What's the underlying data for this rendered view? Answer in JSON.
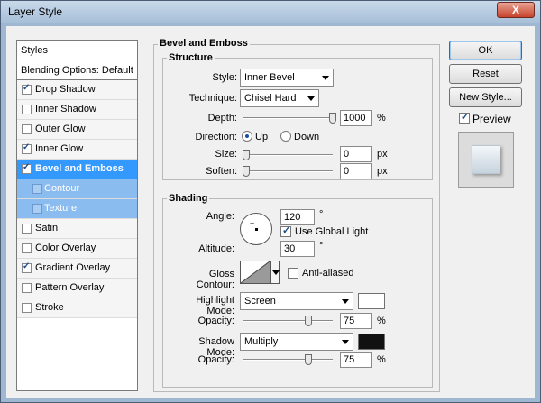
{
  "window": {
    "title": "Layer Style",
    "close_label": "X"
  },
  "left_panel": {
    "header": "Styles",
    "items": [
      {
        "label": "Blending Options: Default",
        "checkbox": false,
        "checked": false,
        "state": "header"
      },
      {
        "label": "Drop Shadow",
        "checkbox": true,
        "checked": true,
        "state": "normal"
      },
      {
        "label": "Inner Shadow",
        "checkbox": true,
        "checked": false,
        "state": "normal"
      },
      {
        "label": "Outer Glow",
        "checkbox": true,
        "checked": false,
        "state": "normal"
      },
      {
        "label": "Inner Glow",
        "checkbox": true,
        "checked": true,
        "state": "normal"
      },
      {
        "label": "Bevel and Emboss",
        "checkbox": true,
        "checked": true,
        "state": "selected"
      },
      {
        "label": "Contour",
        "checkbox": true,
        "checked": false,
        "state": "sub"
      },
      {
        "label": "Texture",
        "checkbox": true,
        "checked": false,
        "state": "sub"
      },
      {
        "label": "Satin",
        "checkbox": true,
        "checked": false,
        "state": "normal"
      },
      {
        "label": "Color Overlay",
        "checkbox": true,
        "checked": false,
        "state": "normal"
      },
      {
        "label": "Gradient Overlay",
        "checkbox": true,
        "checked": true,
        "state": "normal"
      },
      {
        "label": "Pattern Overlay",
        "checkbox": true,
        "checked": false,
        "state": "normal"
      },
      {
        "label": "Stroke",
        "checkbox": true,
        "checked": false,
        "state": "normal"
      }
    ]
  },
  "bevel": {
    "title": "Bevel and Emboss",
    "structure": {
      "title": "Structure",
      "style_label": "Style:",
      "style_value": "Inner Bevel",
      "technique_label": "Technique:",
      "technique_value": "Chisel Hard",
      "depth_label": "Depth:",
      "depth_value": "1000",
      "depth_unit": "%",
      "depth_fraction": 1.0,
      "direction_label": "Direction:",
      "direction_up": "Up",
      "direction_down": "Down",
      "direction_selected": "Up",
      "size_label": "Size:",
      "size_value": "0",
      "size_unit": "px",
      "size_fraction": 0.0,
      "soften_label": "Soften:",
      "soften_value": "0",
      "soften_unit": "px",
      "soften_fraction": 0.0
    },
    "shading": {
      "title": "Shading",
      "angle_label": "Angle:",
      "angle_value": "120",
      "angle_unit": "°",
      "use_global_light": "Use Global Light",
      "use_global_light_checked": true,
      "altitude_label": "Altitude:",
      "altitude_value": "30",
      "altitude_unit": "°",
      "gloss_contour_label": "Gloss Contour:",
      "anti_aliased": "Anti-aliased",
      "anti_aliased_checked": false,
      "highlight_mode_label": "Highlight Mode:",
      "highlight_mode_value": "Screen",
      "highlight_color": "#ffffff",
      "highlight_opacity_label": "Opacity:",
      "highlight_opacity_value": "75",
      "highlight_opacity_unit": "%",
      "highlight_opacity_fraction": 0.75,
      "shadow_mode_label": "Shadow Mode:",
      "shadow_mode_value": "Multiply",
      "shadow_color": "#111111",
      "shadow_opacity_label": "Opacity:",
      "shadow_opacity_value": "75",
      "shadow_opacity_unit": "%",
      "shadow_opacity_fraction": 0.75
    }
  },
  "buttons": {
    "ok": "OK",
    "reset": "Reset",
    "new_style": "New Style...",
    "preview": "Preview",
    "preview_checked": true
  },
  "colors": {
    "selection": "#3399ff",
    "sub_selection": "#8bbcf0",
    "frame": "#9fb7d1"
  }
}
